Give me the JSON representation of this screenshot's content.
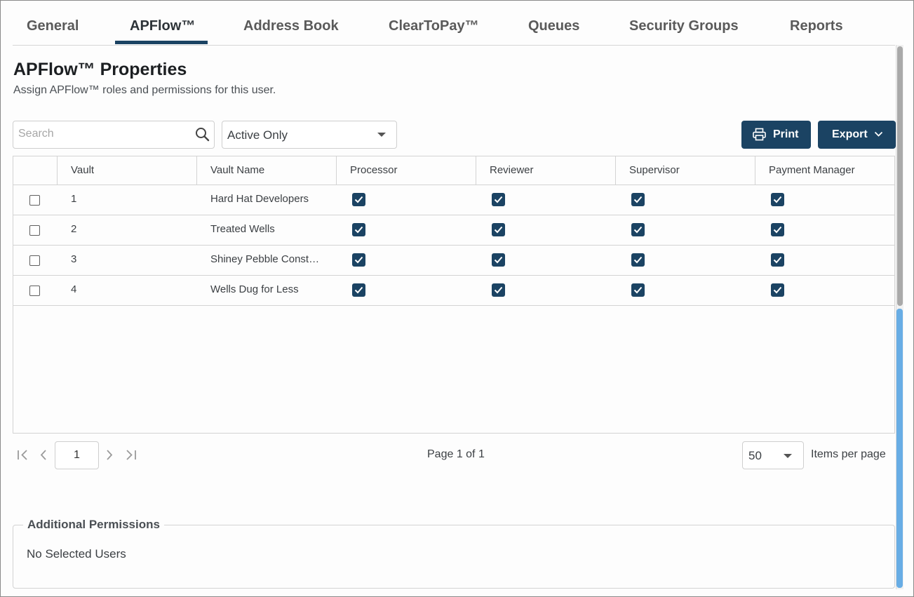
{
  "tabs": [
    {
      "label": "General",
      "active": false
    },
    {
      "label": "APFlow™",
      "active": true
    },
    {
      "label": "Address Book",
      "active": false
    },
    {
      "label": "ClearToPay™",
      "active": false
    },
    {
      "label": "Queues",
      "active": false
    },
    {
      "label": "Security Groups",
      "active": false
    },
    {
      "label": "Reports",
      "active": false
    }
  ],
  "heading": {
    "title": "APFlow™ Properties",
    "subtitle": "Assign APFlow™ roles and permissions for this user."
  },
  "toolbar": {
    "search_placeholder": "Search",
    "search_value": "",
    "status_filter": "Active Only",
    "print_label": "Print",
    "export_label": "Export"
  },
  "grid": {
    "columns": [
      "Vault",
      "Vault Name",
      "Processor",
      "Reviewer",
      "Supervisor",
      "Payment Manager"
    ],
    "rows": [
      {
        "selected": false,
        "vault": "1",
        "name": "Hard Hat Developers",
        "processor": true,
        "reviewer": true,
        "supervisor": true,
        "payment_manager": true
      },
      {
        "selected": false,
        "vault": "2",
        "name": "Treated Wells",
        "processor": true,
        "reviewer": true,
        "supervisor": true,
        "payment_manager": true
      },
      {
        "selected": false,
        "vault": "3",
        "name": "Shiney Pebble Const…",
        "processor": true,
        "reviewer": true,
        "supervisor": true,
        "payment_manager": true
      },
      {
        "selected": false,
        "vault": "4",
        "name": "Wells Dug for Less",
        "processor": true,
        "reviewer": true,
        "supervisor": true,
        "payment_manager": true
      }
    ]
  },
  "pager": {
    "current_page": "1",
    "page_info": "Page 1 of 1",
    "page_size": "50",
    "page_size_label": "Items per page"
  },
  "additional_permissions": {
    "legend": "Additional Permissions",
    "empty_text": "No Selected Users"
  },
  "colors": {
    "accent": "#1b4363",
    "scrollbar_thumb": "#68ade5"
  },
  "icons": [
    "search-icon",
    "printer-icon",
    "chevron-down-icon",
    "first-page-icon",
    "prev-page-icon",
    "next-page-icon",
    "last-page-icon",
    "checkmark-icon"
  ]
}
